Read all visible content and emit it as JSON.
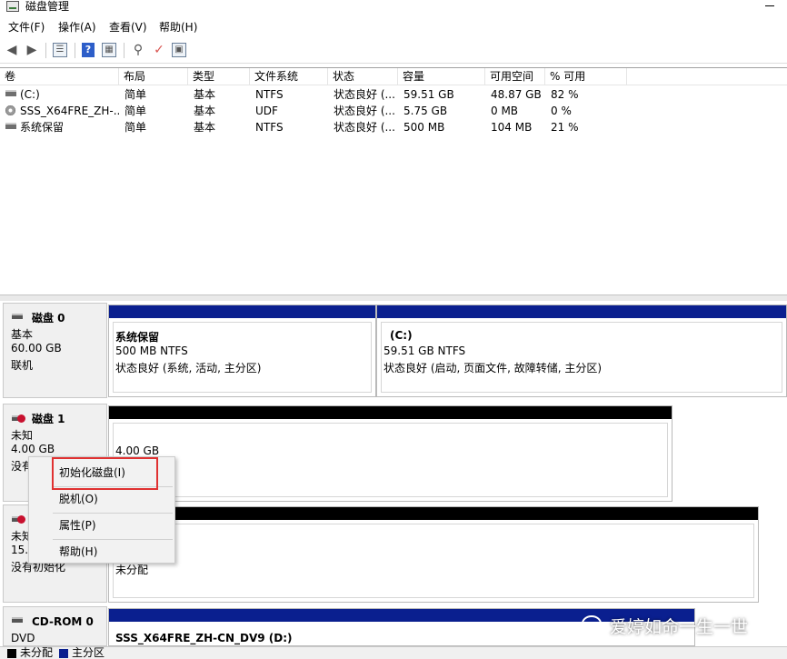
{
  "window": {
    "title": "磁盘管理"
  },
  "menubar": {
    "items": [
      "文件(F)",
      "操作(A)",
      "查看(V)",
      "帮助(H)"
    ]
  },
  "toolbar": {
    "icons": [
      "back-arrow-icon",
      "forward-arrow-icon",
      "list-view-icon",
      "help-icon",
      "properties-icon",
      "connect-icon",
      "check-icon",
      "settings-icon"
    ],
    "help_glyph": "?"
  },
  "volume_table": {
    "columns": [
      "卷",
      "布局",
      "类型",
      "文件系统",
      "状态",
      "容量",
      "可用空间",
      "% 可用"
    ],
    "rows": [
      {
        "icon": "drive-icon",
        "cells": [
          "(C:)",
          "简单",
          "基本",
          "NTFS",
          "状态良好 (...",
          "59.51 GB",
          "48.87 GB",
          "82 %"
        ]
      },
      {
        "icon": "cd-icon",
        "cells": [
          "SSS_X64FRE_ZH-...",
          "简单",
          "基本",
          "UDF",
          "状态良好 (...",
          "5.75 GB",
          "0 MB",
          "0 %"
        ]
      },
      {
        "icon": "drive-icon",
        "cells": [
          "系统保留",
          "简单",
          "基本",
          "NTFS",
          "状态良好 (...",
          "500 MB",
          "104 MB",
          "21 %"
        ]
      }
    ]
  },
  "disks": [
    {
      "name": "磁盘 0",
      "lines": [
        "基本",
        "60.00 GB",
        "联机"
      ],
      "partitions": [
        {
          "title": "系统保留",
          "size": "500 MB NTFS",
          "status": "状态良好 (系统, 活动, 主分区)"
        },
        {
          "title": "(C:)",
          "size": "59.51 GB NTFS",
          "status": "状态良好 (启动, 页面文件, 故障转储, 主分区)"
        }
      ]
    },
    {
      "name": "磁盘 1",
      "lines": [
        "未知",
        "4.00 GB",
        "没有"
      ],
      "partitions": [
        {
          "size": "4.00 GB"
        }
      ]
    },
    {
      "name": "",
      "lines": [
        "未知",
        "15.0",
        "没有初始化"
      ],
      "partitions": [
        {
          "size": "未分配"
        }
      ]
    },
    {
      "name": "CD-ROM 0",
      "lines": [
        "DVD"
      ],
      "partitions": [
        {
          "title": "SSS_X64FRE_ZH-CN_DV9  (D:)"
        }
      ]
    }
  ],
  "context_menu": {
    "items": [
      "初始化磁盘(I)",
      "脱机(O)",
      "属性(P)",
      "帮助(H)"
    ]
  },
  "legend": {
    "items": [
      {
        "label": "未分配",
        "color": "#000000"
      },
      {
        "label": "主分区",
        "color": "#0a1f8f"
      }
    ]
  },
  "watermark": {
    "text": "爱婷如命一生一世"
  },
  "colors": {
    "primary_partition": "#0a1f8f",
    "unallocated": "#000000",
    "highlight": "#e03131"
  }
}
